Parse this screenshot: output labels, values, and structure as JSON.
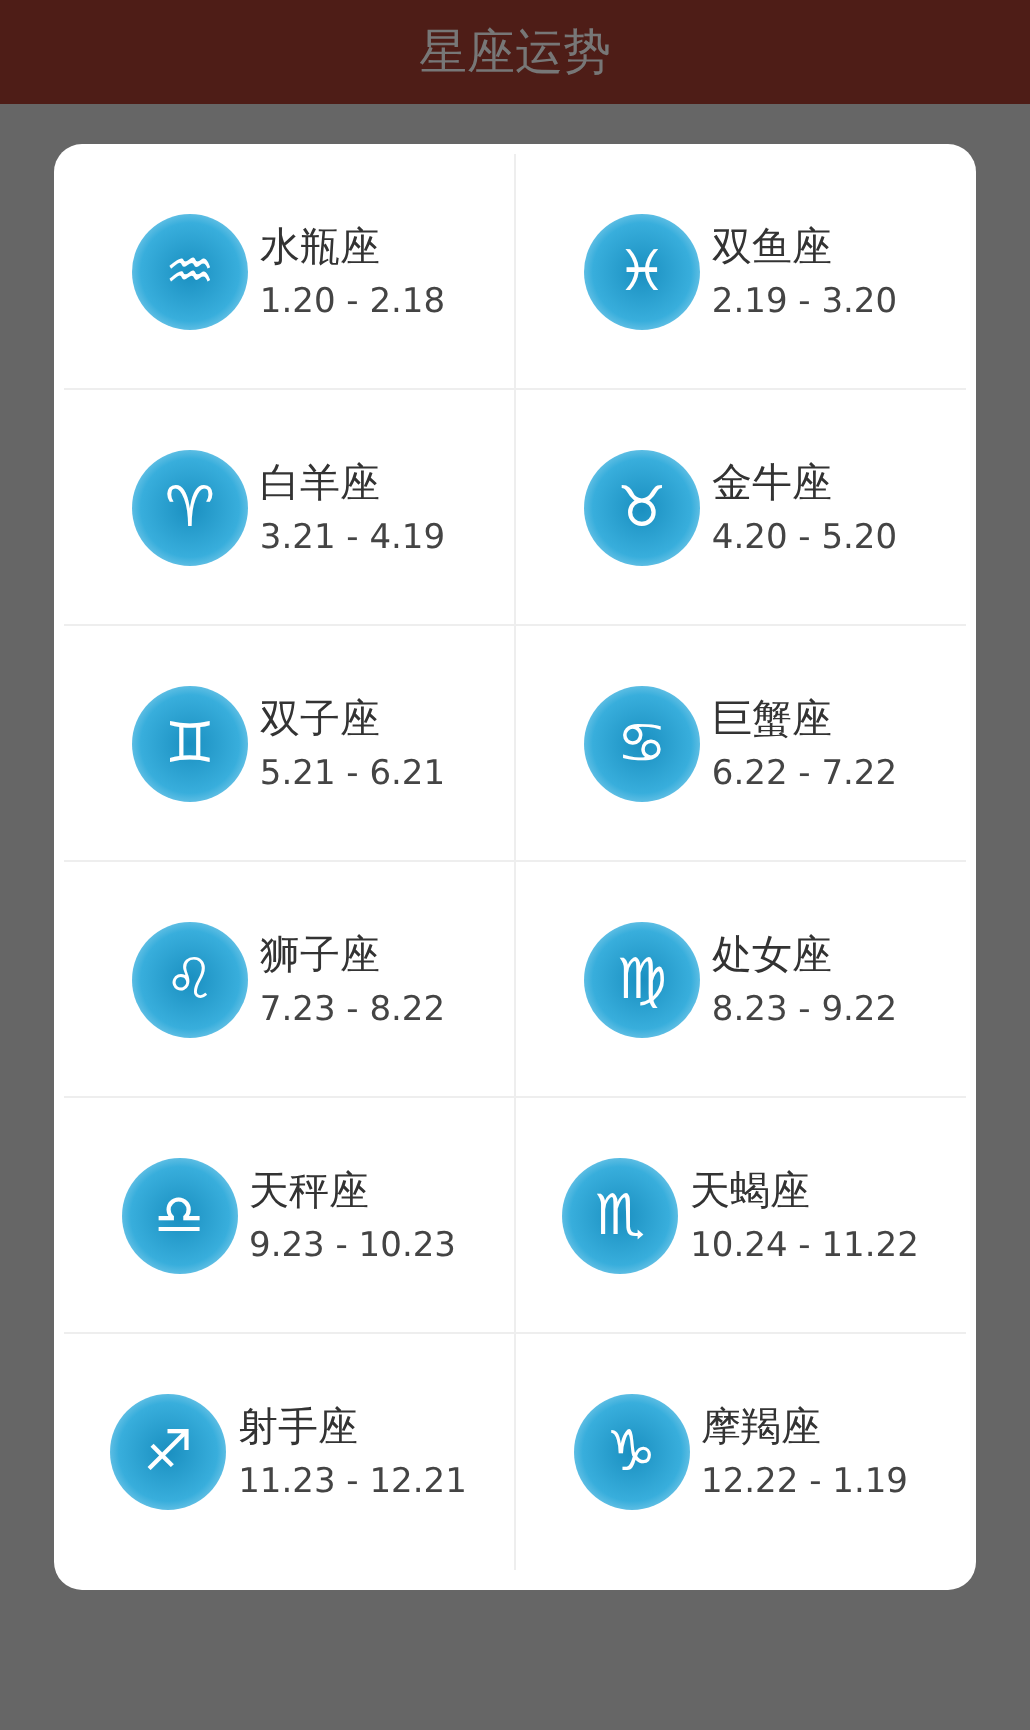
{
  "header": {
    "title": "星座运势"
  },
  "signs": [
    {
      "glyph": "♒",
      "name": "水瓶座",
      "dates": "1.20 - 2.18"
    },
    {
      "glyph": "♓",
      "name": "双鱼座",
      "dates": "2.19 - 3.20"
    },
    {
      "glyph": "♈",
      "name": "白羊座",
      "dates": "3.21 - 4.19"
    },
    {
      "glyph": "♉",
      "name": "金牛座",
      "dates": "4.20 - 5.20"
    },
    {
      "glyph": "♊",
      "name": "双子座",
      "dates": "5.21 - 6.21"
    },
    {
      "glyph": "♋",
      "name": "巨蟹座",
      "dates": "6.22 - 7.22"
    },
    {
      "glyph": "♌",
      "name": "狮子座",
      "dates": "7.23 - 8.22"
    },
    {
      "glyph": "♍",
      "name": "处女座",
      "dates": "8.23 - 9.22"
    },
    {
      "glyph": "♎",
      "name": "天秤座",
      "dates": "9.23 - 10.23"
    },
    {
      "glyph": "♏",
      "name": "天蝎座",
      "dates": "10.24 - 11.22"
    },
    {
      "glyph": "♐",
      "name": "射手座",
      "dates": "11.23 - 12.21"
    },
    {
      "glyph": "♑",
      "name": "摩羯座",
      "dates": "12.22 - 1.19"
    }
  ]
}
